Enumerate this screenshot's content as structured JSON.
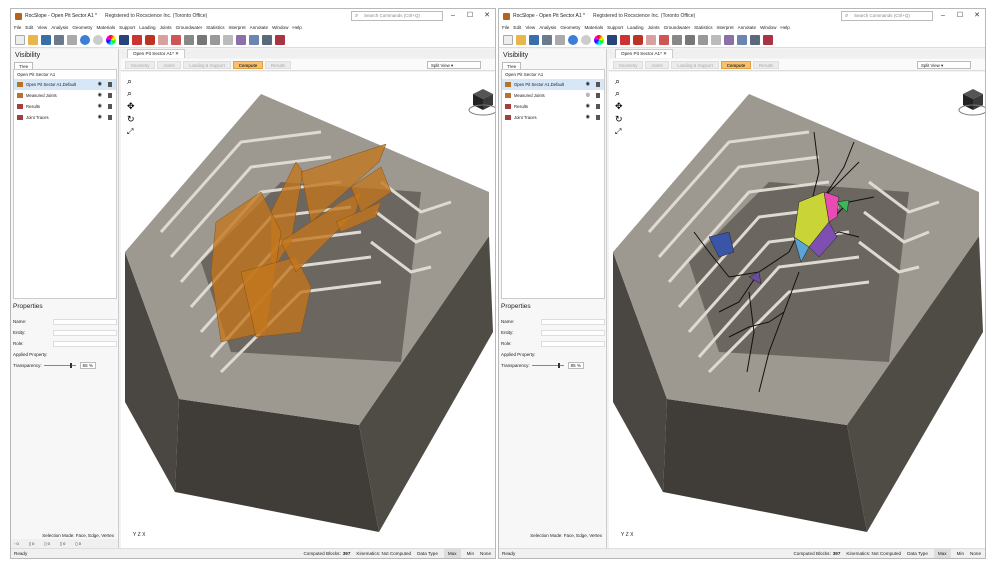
{
  "left_window": {
    "title": "RocSlope - Open Pit Sector A1 *",
    "registered": "Registered to Rocscience Inc. (Toronto Office)",
    "search_placeholder": "Search Commands (Ctrl+Q)",
    "menu": [
      "File",
      "Edit",
      "View",
      "Analysis",
      "Geometry",
      "Materials",
      "Support",
      "Loading",
      "Joints",
      "Groundwater",
      "Statistics",
      "Interpret",
      "Annotate",
      "Window",
      "Help"
    ],
    "visibility_title": "Visibility",
    "tree_tab": "Tree",
    "tree_root": "Open Pit Sector A1",
    "tree_items": [
      "Open Pit Sector A1.Default",
      "Measured Joints",
      "Results",
      "Joint Traces"
    ],
    "doc_tab": "Open Pit Sector A1*",
    "steps": [
      "Geometry",
      "Joints",
      "Loading & Support",
      "Compute",
      "Results"
    ],
    "active_step": "Compute",
    "split_view": "Split View",
    "properties_title": "Properties",
    "prop_labels": [
      "Name:",
      "Entity:",
      "Role:",
      "Applied Property:"
    ],
    "transparency_label": "Transparency:",
    "transparency_value": "65 %",
    "selection_mode": "Selection Mode: Face, Edge, Vertex",
    "axes_label": "Y Z X",
    "status_ready": "Ready",
    "computed_blocks_label": "Computed Blocks:",
    "computed_blocks_value": "397",
    "kinematics": "Kinematics: Not Computed",
    "data_type": "Data Type",
    "max": "Max",
    "min": "Min",
    "none": "None"
  },
  "right_window": {
    "title": "RocSlope - Open Pit Sector A1 *",
    "registered": "Registered to Rocscience Inc. (Toronto Office)",
    "search_placeholder": "Search Commands (Ctrl+Q)",
    "menu": [
      "File",
      "Edit",
      "View",
      "Analysis",
      "Geometry",
      "Materials",
      "Support",
      "Loading",
      "Joints",
      "Groundwater",
      "Statistics",
      "Interpret",
      "Annotate",
      "Window",
      "Help"
    ],
    "visibility_title": "Visibility",
    "tree_tab": "Tree",
    "tree_root": "Open Pit Sector A1",
    "tree_items": [
      "Open Pit Sector A1.Default",
      "Measured Joints",
      "Results",
      "Joint Traces"
    ],
    "doc_tab": "Open Pit Sector A1*",
    "steps": [
      "Geometry",
      "Joints",
      "Loading & Support",
      "Compute",
      "Results"
    ],
    "active_step": "Compute",
    "split_view": "Split View",
    "properties_title": "Properties",
    "prop_labels": [
      "Name:",
      "Entity:",
      "Role:",
      "Applied Property:"
    ],
    "transparency_label": "Transparency:",
    "transparency_value": "85 %",
    "selection_mode": "Selection Mode: Face, Edge, Vertex",
    "axes_label": "Y Z X",
    "status_ready": "Ready",
    "computed_blocks_label": "Computed Blocks:",
    "computed_blocks_value": "397",
    "kinematics": "Kinematics: Not Computed",
    "data_type": "Data Type",
    "max": "Max",
    "min": "Min",
    "none": "None"
  },
  "colors": {
    "joint_planes": "#c4761c",
    "rock_dark": "#5a554f",
    "rock_light": "#b3afa7",
    "active_step": "#f9c26a"
  },
  "icons": [
    "search-icon",
    "minimize-icon",
    "maximize-icon",
    "close-icon",
    "eye-icon",
    "lock-icon",
    "trash-icon",
    "zoom-icon",
    "pan-icon",
    "rotate-icon",
    "view-cube-icon"
  ]
}
